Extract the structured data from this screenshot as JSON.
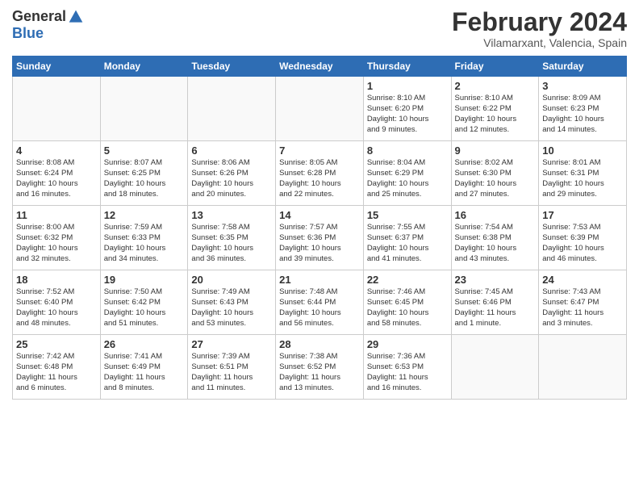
{
  "header": {
    "logo_general": "General",
    "logo_blue": "Blue",
    "month_title": "February 2024",
    "location": "Vilamarxant, Valencia, Spain"
  },
  "days_of_week": [
    "Sunday",
    "Monday",
    "Tuesday",
    "Wednesday",
    "Thursday",
    "Friday",
    "Saturday"
  ],
  "weeks": [
    [
      {
        "day": "",
        "info": ""
      },
      {
        "day": "",
        "info": ""
      },
      {
        "day": "",
        "info": ""
      },
      {
        "day": "",
        "info": ""
      },
      {
        "day": "1",
        "info": "Sunrise: 8:10 AM\nSunset: 6:20 PM\nDaylight: 10 hours\nand 9 minutes."
      },
      {
        "day": "2",
        "info": "Sunrise: 8:10 AM\nSunset: 6:22 PM\nDaylight: 10 hours\nand 12 minutes."
      },
      {
        "day": "3",
        "info": "Sunrise: 8:09 AM\nSunset: 6:23 PM\nDaylight: 10 hours\nand 14 minutes."
      }
    ],
    [
      {
        "day": "4",
        "info": "Sunrise: 8:08 AM\nSunset: 6:24 PM\nDaylight: 10 hours\nand 16 minutes."
      },
      {
        "day": "5",
        "info": "Sunrise: 8:07 AM\nSunset: 6:25 PM\nDaylight: 10 hours\nand 18 minutes."
      },
      {
        "day": "6",
        "info": "Sunrise: 8:06 AM\nSunset: 6:26 PM\nDaylight: 10 hours\nand 20 minutes."
      },
      {
        "day": "7",
        "info": "Sunrise: 8:05 AM\nSunset: 6:28 PM\nDaylight: 10 hours\nand 22 minutes."
      },
      {
        "day": "8",
        "info": "Sunrise: 8:04 AM\nSunset: 6:29 PM\nDaylight: 10 hours\nand 25 minutes."
      },
      {
        "day": "9",
        "info": "Sunrise: 8:02 AM\nSunset: 6:30 PM\nDaylight: 10 hours\nand 27 minutes."
      },
      {
        "day": "10",
        "info": "Sunrise: 8:01 AM\nSunset: 6:31 PM\nDaylight: 10 hours\nand 29 minutes."
      }
    ],
    [
      {
        "day": "11",
        "info": "Sunrise: 8:00 AM\nSunset: 6:32 PM\nDaylight: 10 hours\nand 32 minutes."
      },
      {
        "day": "12",
        "info": "Sunrise: 7:59 AM\nSunset: 6:33 PM\nDaylight: 10 hours\nand 34 minutes."
      },
      {
        "day": "13",
        "info": "Sunrise: 7:58 AM\nSunset: 6:35 PM\nDaylight: 10 hours\nand 36 minutes."
      },
      {
        "day": "14",
        "info": "Sunrise: 7:57 AM\nSunset: 6:36 PM\nDaylight: 10 hours\nand 39 minutes."
      },
      {
        "day": "15",
        "info": "Sunrise: 7:55 AM\nSunset: 6:37 PM\nDaylight: 10 hours\nand 41 minutes."
      },
      {
        "day": "16",
        "info": "Sunrise: 7:54 AM\nSunset: 6:38 PM\nDaylight: 10 hours\nand 43 minutes."
      },
      {
        "day": "17",
        "info": "Sunrise: 7:53 AM\nSunset: 6:39 PM\nDaylight: 10 hours\nand 46 minutes."
      }
    ],
    [
      {
        "day": "18",
        "info": "Sunrise: 7:52 AM\nSunset: 6:40 PM\nDaylight: 10 hours\nand 48 minutes."
      },
      {
        "day": "19",
        "info": "Sunrise: 7:50 AM\nSunset: 6:42 PM\nDaylight: 10 hours\nand 51 minutes."
      },
      {
        "day": "20",
        "info": "Sunrise: 7:49 AM\nSunset: 6:43 PM\nDaylight: 10 hours\nand 53 minutes."
      },
      {
        "day": "21",
        "info": "Sunrise: 7:48 AM\nSunset: 6:44 PM\nDaylight: 10 hours\nand 56 minutes."
      },
      {
        "day": "22",
        "info": "Sunrise: 7:46 AM\nSunset: 6:45 PM\nDaylight: 10 hours\nand 58 minutes."
      },
      {
        "day": "23",
        "info": "Sunrise: 7:45 AM\nSunset: 6:46 PM\nDaylight: 11 hours\nand 1 minute."
      },
      {
        "day": "24",
        "info": "Sunrise: 7:43 AM\nSunset: 6:47 PM\nDaylight: 11 hours\nand 3 minutes."
      }
    ],
    [
      {
        "day": "25",
        "info": "Sunrise: 7:42 AM\nSunset: 6:48 PM\nDaylight: 11 hours\nand 6 minutes."
      },
      {
        "day": "26",
        "info": "Sunrise: 7:41 AM\nSunset: 6:49 PM\nDaylight: 11 hours\nand 8 minutes."
      },
      {
        "day": "27",
        "info": "Sunrise: 7:39 AM\nSunset: 6:51 PM\nDaylight: 11 hours\nand 11 minutes."
      },
      {
        "day": "28",
        "info": "Sunrise: 7:38 AM\nSunset: 6:52 PM\nDaylight: 11 hours\nand 13 minutes."
      },
      {
        "day": "29",
        "info": "Sunrise: 7:36 AM\nSunset: 6:53 PM\nDaylight: 11 hours\nand 16 minutes."
      },
      {
        "day": "",
        "info": ""
      },
      {
        "day": "",
        "info": ""
      }
    ]
  ]
}
